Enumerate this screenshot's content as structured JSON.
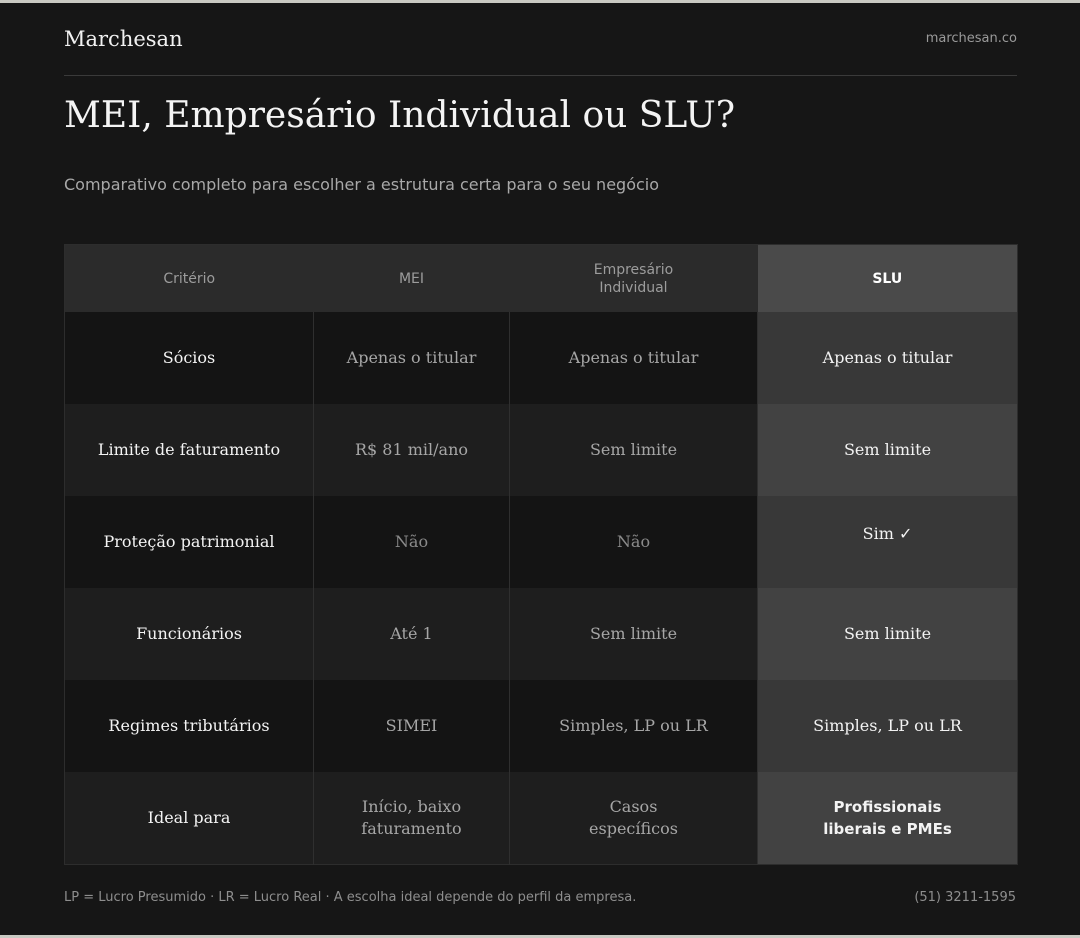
{
  "header": {
    "brand": "Marchesan",
    "site": "marchesan.co"
  },
  "title": "MEI, Empresário Individual ou SLU?",
  "subtitle": "Comparativo completo para escolher a estrutura certa para o seu negócio",
  "table": {
    "columns": [
      "Critério",
      "MEI",
      "Empresário\nIndividual",
      "SLU"
    ],
    "rows": [
      {
        "criterion": "Sócios",
        "mei": "Apenas o titular",
        "ei": "Apenas o titular",
        "slu": "Apenas o titular"
      },
      {
        "criterion": "Limite de faturamento",
        "mei": "R$ 81 mil/ano",
        "ei": "Sem limite",
        "slu": "Sem limite"
      },
      {
        "criterion": "Proteção patrimonial",
        "mei": "Não",
        "ei": "Não",
        "slu": "Sim ✓"
      },
      {
        "criterion": "Funcionários",
        "mei": "Até 1",
        "ei": "Sem limite",
        "slu": "Sem limite"
      },
      {
        "criterion": "Regimes tributários",
        "mei": "SIMEI",
        "ei": "Simples, LP ou LR",
        "slu": "Simples, LP ou LR"
      },
      {
        "criterion": "Ideal para",
        "mei": "Início, baixo\nfaturamento",
        "ei": "Casos\nespecíficos",
        "slu": "Profissionais\nliberais e PMEs"
      }
    ]
  },
  "footer": {
    "note": "LP = Lucro Presumido  ·  LR = Lucro Real  ·  A escolha ideal depende do perfil da empresa.",
    "phone": "(51) 3211-1595"
  },
  "colors": {
    "background": "#161616",
    "highlight_column": "#424242",
    "text_primary": "#f3f3f3",
    "text_muted": "#a6a6a6"
  }
}
